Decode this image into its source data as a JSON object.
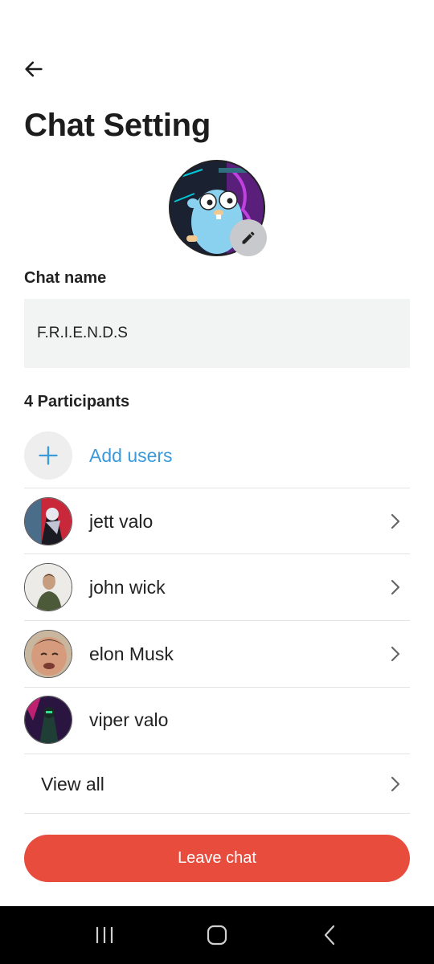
{
  "header": {
    "title": "Chat Setting"
  },
  "chat_name": {
    "label": "Chat name",
    "value": "F.R.I.E.N.D.S"
  },
  "participants": {
    "label": "4 Participants",
    "add_label": "Add users",
    "members": [
      {
        "name": "jett valo",
        "has_chevron": true
      },
      {
        "name": "john wick",
        "has_chevron": true
      },
      {
        "name": "elon Musk",
        "has_chevron": true
      },
      {
        "name": "viper valo",
        "has_chevron": false
      }
    ],
    "view_all": "View all"
  },
  "actions": {
    "leave_label": "Leave chat"
  },
  "colors": {
    "accent_blue": "#3b9ad9",
    "danger": "#e84c3d",
    "field_bg": "#f1f4f3"
  },
  "icons": {
    "back": "arrow-left-icon",
    "edit": "pencil-icon",
    "add": "plus-icon",
    "chevron": "chevron-right-icon",
    "nav_recents": "recents-icon",
    "nav_home": "home-icon",
    "nav_back": "back-icon"
  }
}
